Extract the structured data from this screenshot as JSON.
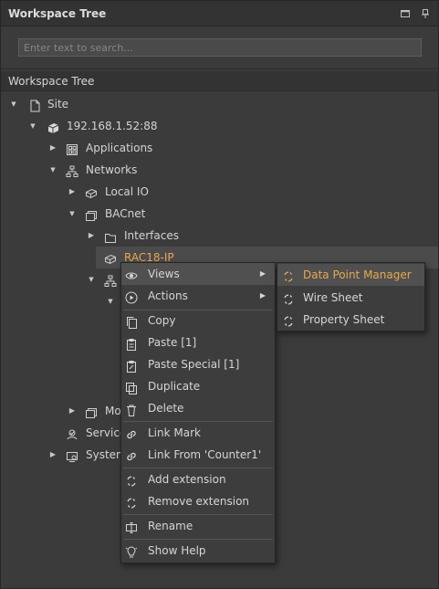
{
  "window": {
    "title": "Workspace Tree"
  },
  "search": {
    "placeholder": "Enter text to search..."
  },
  "section": {
    "title": "Workspace Tree"
  },
  "tree": {
    "site": "Site",
    "host": "192.168.1.52:88",
    "applications": "Applications",
    "networks": "Networks",
    "local_io": "Local IO",
    "bacnet": "BACnet",
    "interfaces": "Interfaces",
    "rac18": "RAC18-IP",
    "modbus_partial": "Mo",
    "services_partial": "Service",
    "system_partial": "System"
  },
  "context_menu": {
    "views": "Views",
    "actions": "Actions",
    "copy": "Copy",
    "paste": "Paste [1]",
    "paste_special": "Paste Special [1]",
    "duplicate": "Duplicate",
    "delete": "Delete",
    "link_mark": "Link Mark",
    "link_from": "Link From 'Counter1'",
    "add_extension": "Add extension",
    "remove_extension": "Remove extension",
    "rename": "Rename",
    "show_help": "Show Help"
  },
  "views_submenu": {
    "data_point_manager": "Data Point Manager",
    "wire_sheet": "Wire Sheet",
    "property_sheet": "Property Sheet"
  },
  "colors": {
    "accent": "#e9a84a",
    "background": "#3b3b3b",
    "highlight": "#505050"
  }
}
